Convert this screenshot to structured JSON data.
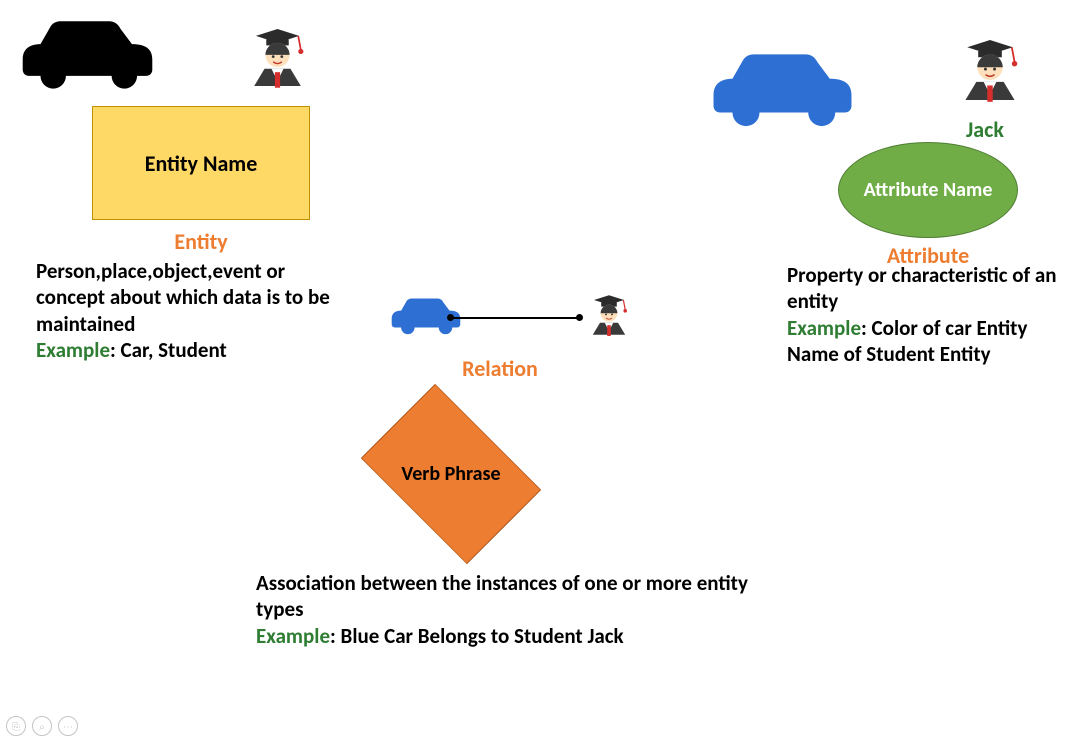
{
  "entity": {
    "shape_label": "Entity Name",
    "title": "Entity",
    "description": "Person,place,object,event or concept about which data is to be maintained",
    "example_label": "Example",
    "example_text": ": Car, Student"
  },
  "attribute": {
    "shape_label": "Attribute Name",
    "title": "Attribute",
    "description": "Property or characteristic of an entity",
    "example_label": "Example",
    "example_text": ": Color of car Entity Name of Student Entity",
    "jack_label": "Jack"
  },
  "relation": {
    "shape_label": "Verb Phrase",
    "title": "Relation",
    "description": "Association between the instances of one or more entity types",
    "example_label": "Example",
    "example_text": ": Blue Car Belongs to Student Jack"
  },
  "icons": {
    "car_black": "car-icon",
    "car_blue": "car-icon",
    "student": "student-icon"
  },
  "toolbar": {
    "copy": "⎘",
    "zoom": "⌕",
    "more": "⋯"
  },
  "colors": {
    "entity_fill": "#ffd966",
    "entity_border": "#bf9000",
    "attribute_fill": "#70ad47",
    "relation_fill": "#ed7d31",
    "accent_text": "#ed7d31",
    "example_green": "#2e7d32"
  }
}
